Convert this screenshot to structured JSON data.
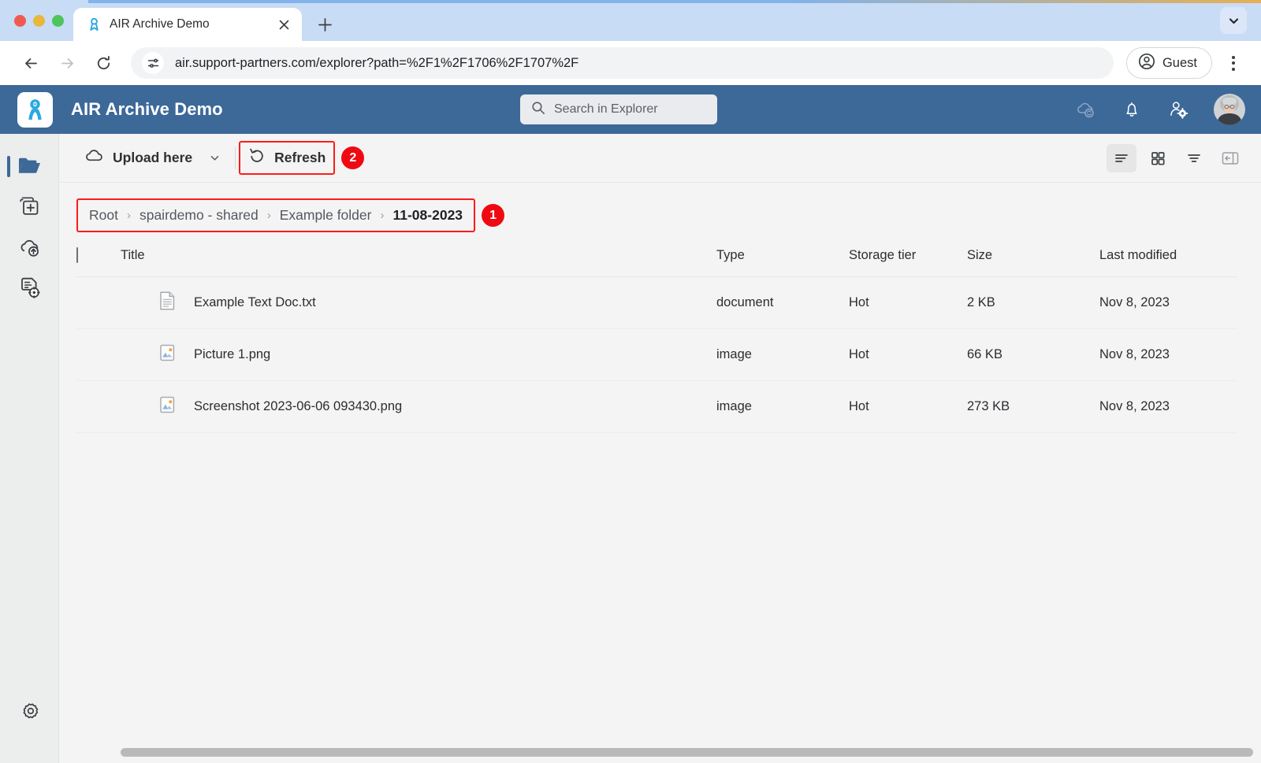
{
  "browser": {
    "tab": {
      "title": "AIR Archive Demo",
      "favicon_icon": "air-ribbon-icon",
      "close_icon": "close-icon"
    },
    "newtab_icon": "plus-icon",
    "tablist_chevron_icon": "chevron-down-icon",
    "back_icon": "arrow-left-icon",
    "forward_icon": "arrow-right-icon",
    "reload_icon": "reload-icon",
    "site_info_icon": "site-settings-icon",
    "url": "air.support-partners.com/explorer?path=%2F1%2F1706%2F1707%2F",
    "profile": {
      "label": "Guest",
      "icon": "account-circle-icon"
    },
    "menu_icon": "kebab-menu-icon"
  },
  "app": {
    "logo_icon": "air-logo-icon",
    "title": "AIR Archive Demo",
    "search": {
      "placeholder": "Search in Explorer",
      "icon": "search-icon"
    },
    "header_icons": [
      {
        "name": "cloud-sync-icon"
      },
      {
        "name": "notification-bell-icon"
      },
      {
        "name": "user-settings-icon"
      }
    ],
    "avatar": {
      "name": "user-avatar"
    },
    "colors": {
      "header_blue": "#3d6999",
      "accent_cyan": "#29a9e0",
      "annotation_red": "#ef0a12",
      "sidebar_bg": "#eceded",
      "content_bg": "#f4f4f4"
    }
  },
  "sidebar": {
    "items": [
      {
        "icon": "open-folder-icon",
        "label": "Explorer",
        "active": true
      },
      {
        "icon": "add-collection-icon",
        "label": "New collection",
        "active": false
      },
      {
        "icon": "cloud-upload-icon",
        "label": "Uploads",
        "active": false
      },
      {
        "icon": "document-settings-icon",
        "label": "Jobs",
        "active": false
      }
    ],
    "bottom": {
      "icon": "gear-icon",
      "label": "Settings"
    }
  },
  "toolbar": {
    "upload_label": "Upload here",
    "upload_icon": "cloud-icon",
    "upload_caret_icon": "chevron-down-icon",
    "refresh_label": "Refresh",
    "refresh_icon": "refresh-icon",
    "view_buttons": [
      {
        "icon": "list-view-icon",
        "selected": true
      },
      {
        "icon": "grid-view-icon",
        "selected": false
      },
      {
        "icon": "filter-icon",
        "selected": false
      },
      {
        "icon": "collapse-panel-icon",
        "selected": false
      }
    ]
  },
  "annotations": [
    {
      "number": "1",
      "target": "breadcrumb"
    },
    {
      "number": "2",
      "target": "refresh-button"
    }
  ],
  "breadcrumb": {
    "separator": "›",
    "items": [
      {
        "label": "Root",
        "current": false
      },
      {
        "label": "spairdemo - shared",
        "current": false
      },
      {
        "label": "Example folder",
        "current": false
      },
      {
        "label": "11-08-2023",
        "current": true
      }
    ]
  },
  "table": {
    "columns": [
      "Title",
      "Type",
      "Storage tier",
      "Size",
      "Last modified"
    ],
    "select_all_checked": false,
    "rows": [
      {
        "icon": "text-document-icon",
        "title": "Example Text Doc.txt",
        "type": "document",
        "tier": "Hot",
        "size": "2 KB",
        "modified": "Nov 8, 2023"
      },
      {
        "icon": "image-file-icon",
        "title": "Picture 1.png",
        "type": "image",
        "tier": "Hot",
        "size": "66 KB",
        "modified": "Nov 8, 2023"
      },
      {
        "icon": "image-file-icon",
        "title": "Screenshot 2023-06-06 093430.png",
        "type": "image",
        "tier": "Hot",
        "size": "273 KB",
        "modified": "Nov 8, 2023"
      }
    ]
  }
}
